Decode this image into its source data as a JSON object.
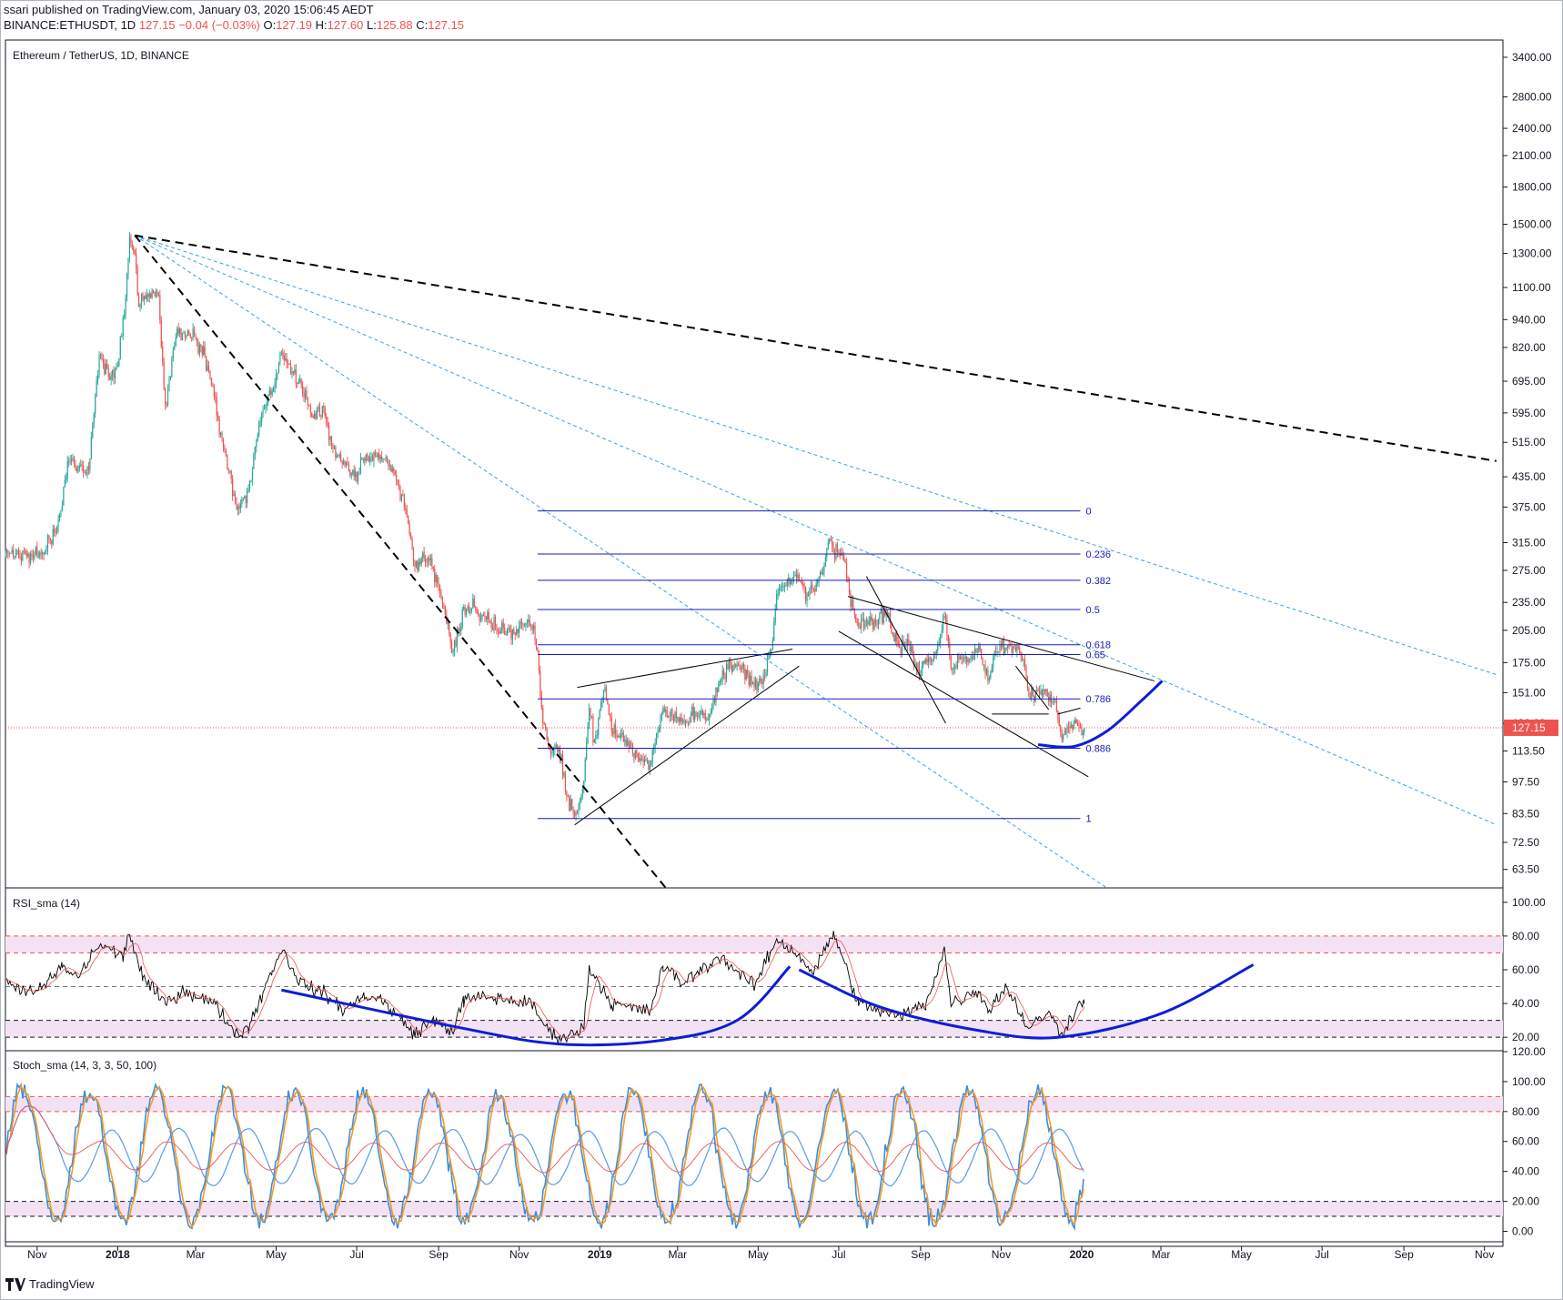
{
  "header": {
    "publisher": "ssari published on TradingView.com, January 03, 2020 15:06:45 AEDT",
    "symbol": "BINANCE:ETHUSDT, 1D",
    "last": "127.15",
    "change": "−0.04 (−0.03%)",
    "o_label": "O:",
    "o": "127.19",
    "h_label": "H:",
    "h": "127.60",
    "l_label": "L:",
    "l": "125.88",
    "c_label": "C:",
    "c": "127.15"
  },
  "footer": {
    "brand": "TradingView"
  },
  "colors": {
    "up": "#26a69a",
    "down": "#ef5350",
    "fib": "#1a1ab8",
    "arc": "#0d1ed6",
    "trend": "#000000",
    "fan": "#3aa3e3",
    "rsi": "#000000",
    "stoch_k": "#3d8ee0",
    "stoch_d": "#f59a23",
    "slow1": "#ef5350",
    "slow2": "#5b9be6"
  },
  "chart_data": [
    {
      "type": "candlestick",
      "title": "Ethereum / TetherUS, 1D, BINANCE",
      "scale": "log",
      "ylim": [
        58,
        3700
      ],
      "x_range": [
        "2017-10-08",
        "2020-11-15"
      ],
      "y_ticks": [
        "3400.00",
        "2800.00",
        "2400.00",
        "2100.00",
        "1800.00",
        "1500.00",
        "1300.00",
        "1100.00",
        "940.00",
        "820.00",
        "695.00",
        "595.00",
        "515.00",
        "435.00",
        "375.00",
        "315.00",
        "275.00",
        "235.00",
        "205.00",
        "175.00",
        "151.00",
        "130.00",
        "113.50",
        "97.50",
        "83.50",
        "72.50",
        "63.50"
      ],
      "last_price": "127.15",
      "close_path": [
        [
          "2017-10-08",
          300
        ],
        [
          "2017-10-25",
          298
        ],
        [
          "2017-11-05",
          300
        ],
        [
          "2017-11-15",
          330
        ],
        [
          "2017-11-25",
          470
        ],
        [
          "2017-12-03",
          460
        ],
        [
          "2017-12-10",
          450
        ],
        [
          "2017-12-18",
          790
        ],
        [
          "2017-12-26",
          700
        ],
        [
          "2018-01-01",
          750
        ],
        [
          "2018-01-07",
          1050
        ],
        [
          "2018-01-10",
          1410
        ],
        [
          "2018-01-14",
          1300
        ],
        [
          "2018-01-17",
          1000
        ],
        [
          "2018-01-24",
          1050
        ],
        [
          "2018-02-01",
          1060
        ],
        [
          "2018-02-06",
          620
        ],
        [
          "2018-02-15",
          900
        ],
        [
          "2018-02-22",
          870
        ],
        [
          "2018-03-01",
          860
        ],
        [
          "2018-03-10",
          750
        ],
        [
          "2018-03-20",
          540
        ],
        [
          "2018-04-01",
          370
        ],
        [
          "2018-04-10",
          410
        ],
        [
          "2018-04-20",
          590
        ],
        [
          "2018-04-28",
          660
        ],
        [
          "2018-05-05",
          800
        ],
        [
          "2018-05-13",
          730
        ],
        [
          "2018-05-20",
          680
        ],
        [
          "2018-05-29",
          580
        ],
        [
          "2018-06-06",
          610
        ],
        [
          "2018-06-12",
          510
        ],
        [
          "2018-06-22",
          460
        ],
        [
          "2018-06-29",
          435
        ],
        [
          "2018-07-07",
          470
        ],
        [
          "2018-07-16",
          480
        ],
        [
          "2018-07-24",
          470
        ],
        [
          "2018-08-01",
          420
        ],
        [
          "2018-08-08",
          360
        ],
        [
          "2018-08-14",
          280
        ],
        [
          "2018-08-20",
          300
        ],
        [
          "2018-08-27",
          280
        ],
        [
          "2018-09-05",
          230
        ],
        [
          "2018-09-12",
          185
        ],
        [
          "2018-09-20",
          230
        ],
        [
          "2018-09-28",
          230
        ],
        [
          "2018-10-05",
          220
        ],
        [
          "2018-10-15",
          205
        ],
        [
          "2018-10-25",
          205
        ],
        [
          "2018-11-05",
          210
        ],
        [
          "2018-11-12",
          210
        ],
        [
          "2018-11-15",
          185
        ],
        [
          "2018-11-19",
          130
        ],
        [
          "2018-11-25",
          112
        ],
        [
          "2018-12-01",
          115
        ],
        [
          "2018-12-07",
          91
        ],
        [
          "2018-12-15",
          84
        ],
        [
          "2018-12-20",
          98
        ],
        [
          "2018-12-24",
          140
        ],
        [
          "2018-12-28",
          120
        ],
        [
          "2019-01-05",
          155
        ],
        [
          "2019-01-10",
          125
        ],
        [
          "2019-01-20",
          120
        ],
        [
          "2019-01-30",
          110
        ],
        [
          "2019-02-08",
          106
        ],
        [
          "2019-02-18",
          140
        ],
        [
          "2019-02-25",
          135
        ],
        [
          "2019-03-05",
          132
        ],
        [
          "2019-03-15",
          137
        ],
        [
          "2019-03-25",
          136
        ],
        [
          "2019-04-02",
          160
        ],
        [
          "2019-04-10",
          172
        ],
        [
          "2019-04-20",
          170
        ],
        [
          "2019-04-28",
          155
        ],
        [
          "2019-05-05",
          165
        ],
        [
          "2019-05-12",
          195
        ],
        [
          "2019-05-15",
          245
        ],
        [
          "2019-05-21",
          255
        ],
        [
          "2019-05-30",
          265
        ],
        [
          "2019-06-07",
          245
        ],
        [
          "2019-06-12",
          250
        ],
        [
          "2019-06-18",
          270
        ],
        [
          "2019-06-24",
          320
        ],
        [
          "2019-06-27",
          300
        ],
        [
          "2019-07-01",
          300
        ],
        [
          "2019-07-06",
          285
        ],
        [
          "2019-07-10",
          230
        ],
        [
          "2019-07-16",
          210
        ],
        [
          "2019-07-22",
          215
        ],
        [
          "2019-07-29",
          212
        ],
        [
          "2019-08-06",
          225
        ],
        [
          "2019-08-15",
          190
        ],
        [
          "2019-08-23",
          192
        ],
        [
          "2019-08-29",
          168
        ],
        [
          "2019-09-05",
          178
        ],
        [
          "2019-09-12",
          182
        ],
        [
          "2019-09-19",
          220
        ],
        [
          "2019-09-24",
          170
        ],
        [
          "2019-10-01",
          180
        ],
        [
          "2019-10-08",
          178
        ],
        [
          "2019-10-15",
          190
        ],
        [
          "2019-10-22",
          160
        ],
        [
          "2019-10-27",
          185
        ],
        [
          "2019-11-05",
          188
        ],
        [
          "2019-11-12",
          185
        ],
        [
          "2019-11-18",
          178
        ],
        [
          "2019-11-22",
          148
        ],
        [
          "2019-11-29",
          152
        ],
        [
          "2019-12-06",
          148
        ],
        [
          "2019-12-12",
          145
        ],
        [
          "2019-12-17",
          120
        ],
        [
          "2019-12-21",
          128
        ],
        [
          "2019-12-28",
          130
        ],
        [
          "2020-01-03",
          127
        ]
      ],
      "fibonacci": {
        "x_start": "2018-11-15",
        "x_end": "2019-12-31",
        "levels": [
          {
            "label": "0",
            "value": 368
          },
          {
            "label": "0.236",
            "value": 298
          },
          {
            "label": "0.382",
            "value": 262
          },
          {
            "label": "0.5",
            "value": 227
          },
          {
            "label": "0.618",
            "value": 191
          },
          {
            "label": "0.65",
            "value": 182
          },
          {
            "label": "0.786",
            "value": 146.5
          },
          {
            "label": "0.886",
            "value": 115
          },
          {
            "label": "1",
            "value": 81.5
          }
        ]
      },
      "trendlines_dashed_black": [
        [
          [
            "2018-01-14",
            1420
          ],
          [
            "2020-11-10",
            470
          ]
        ],
        [
          [
            "2018-01-14",
            1420
          ],
          [
            "2019-02-20",
            58
          ]
        ]
      ],
      "trendlines_dashed_blue": [
        [
          [
            "2018-01-14",
            1420
          ],
          [
            "2020-11-10",
            165
          ]
        ],
        [
          [
            "2018-01-14",
            1420
          ],
          [
            "2020-11-10",
            79
          ]
        ],
        [
          [
            "2018-01-14",
            1420
          ],
          [
            "2020-01-20",
            58
          ]
        ]
      ],
      "trendlines_solid_black": [
        [
          [
            "2018-12-13",
            79
          ],
          [
            "2019-06-01",
            172
          ]
        ],
        [
          [
            "2018-12-15",
            155
          ],
          [
            "2019-05-27",
            187
          ]
        ],
        [
          [
            "2019-07-22",
            267
          ],
          [
            "2019-09-20",
            130
          ]
        ],
        [
          [
            "2019-07-08",
            242
          ],
          [
            "2020-02-25",
            160
          ]
        ],
        [
          [
            "2019-07-01",
            204
          ],
          [
            "2020-01-06",
            100
          ]
        ],
        [
          [
            "2019-10-25",
            136
          ],
          [
            "2019-12-07",
            136
          ]
        ],
        [
          [
            "2019-11-12",
            172
          ],
          [
            "2019-12-07",
            139
          ]
        ],
        [
          [
            "2019-12-14",
            136
          ],
          [
            "2019-12-31",
            140
          ]
        ]
      ],
      "arc": [
        [
          "2019-11-29",
          117
        ],
        [
          "2019-12-26",
          116
        ],
        [
          "2020-01-20",
          125
        ],
        [
          "2020-02-15",
          145
        ],
        [
          "2020-03-02",
          160
        ]
      ]
    },
    {
      "type": "line",
      "title": "RSI_sma (14)",
      "ylim": [
        12,
        108
      ],
      "y_ticks": [
        "100.00",
        "80.00",
        "60.00",
        "40.00",
        "20.00"
      ],
      "bands": {
        "overbought": [
          70,
          80
        ],
        "oversold": [
          20,
          30
        ]
      },
      "rsi_path": [
        [
          "2017-10-08",
          52
        ],
        [
          "2017-11-01",
          46
        ],
        [
          "2017-11-20",
          62
        ],
        [
          "2017-12-01",
          55
        ],
        [
          "2017-12-18",
          75
        ],
        [
          "2018-01-05",
          68
        ],
        [
          "2018-01-10",
          82
        ],
        [
          "2018-01-20",
          55
        ],
        [
          "2018-02-06",
          40
        ],
        [
          "2018-02-20",
          48
        ],
        [
          "2018-03-15",
          40
        ],
        [
          "2018-04-01",
          22
        ],
        [
          "2018-04-10",
          26
        ],
        [
          "2018-04-28",
          60
        ],
        [
          "2018-05-05",
          72
        ],
        [
          "2018-05-20",
          52
        ],
        [
          "2018-06-06",
          46
        ],
        [
          "2018-06-22",
          36
        ],
        [
          "2018-07-07",
          45
        ],
        [
          "2018-07-20",
          42
        ],
        [
          "2018-08-14",
          22
        ],
        [
          "2018-08-27",
          30
        ],
        [
          "2018-09-12",
          24
        ],
        [
          "2018-09-20",
          42
        ],
        [
          "2018-10-05",
          44
        ],
        [
          "2018-10-25",
          42
        ],
        [
          "2018-11-10",
          40
        ],
        [
          "2018-11-25",
          22
        ],
        [
          "2018-12-07",
          20
        ],
        [
          "2018-12-20",
          26
        ],
        [
          "2018-12-24",
          62
        ],
        [
          "2019-01-10",
          40
        ],
        [
          "2019-02-08",
          35
        ],
        [
          "2019-02-18",
          62
        ],
        [
          "2019-03-05",
          52
        ],
        [
          "2019-04-02",
          68
        ],
        [
          "2019-04-28",
          50
        ],
        [
          "2019-05-15",
          78
        ],
        [
          "2019-05-30",
          70
        ],
        [
          "2019-06-12",
          58
        ],
        [
          "2019-06-27",
          82
        ],
        [
          "2019-07-16",
          40
        ],
        [
          "2019-08-15",
          32
        ],
        [
          "2019-09-05",
          40
        ],
        [
          "2019-09-19",
          72
        ],
        [
          "2019-09-24",
          40
        ],
        [
          "2019-10-15",
          48
        ],
        [
          "2019-10-22",
          36
        ],
        [
          "2019-11-05",
          50
        ],
        [
          "2019-11-22",
          25
        ],
        [
          "2019-12-06",
          35
        ],
        [
          "2019-12-17",
          22
        ],
        [
          "2019-12-28",
          38
        ],
        [
          "2020-01-03",
          40
        ]
      ],
      "arcs": [
        [
          [
            "2018-05-05",
            48
          ],
          [
            "2018-09-15",
            26
          ],
          [
            "2018-12-01",
            16
          ],
          [
            "2019-02-15",
            18
          ],
          [
            "2019-04-15",
            30
          ],
          [
            "2019-05-25",
            62
          ]
        ],
        [
          [
            "2019-06-01",
            60
          ],
          [
            "2019-08-01",
            38
          ],
          [
            "2019-10-15",
            24
          ],
          [
            "2019-12-15",
            20
          ],
          [
            "2020-03-01",
            34
          ],
          [
            "2020-05-10",
            63
          ]
        ]
      ]
    },
    {
      "type": "line",
      "title": "Stoch_sma (14, 3, 3, 50, 100)",
      "ylim": [
        -7,
        120
      ],
      "y_ticks": [
        "120.00",
        "100.00",
        "80.00",
        "60.00",
        "40.00",
        "20.00",
        "0.00"
      ],
      "bands": {
        "overbought": [
          80,
          90
        ],
        "oversold": [
          10,
          20
        ]
      }
    }
  ],
  "x_axis": {
    "labels": [
      {
        "label": "Nov",
        "date": "2017-11-01"
      },
      {
        "label": "2018",
        "date": "2018-01-01",
        "bold": true
      },
      {
        "label": "Mar",
        "date": "2018-03-01"
      },
      {
        "label": "May",
        "date": "2018-05-01"
      },
      {
        "label": "Jul",
        "date": "2018-07-01"
      },
      {
        "label": "Sep",
        "date": "2018-09-01"
      },
      {
        "label": "Nov",
        "date": "2018-11-01"
      },
      {
        "label": "2019",
        "date": "2019-01-01",
        "bold": true
      },
      {
        "label": "Mar",
        "date": "2019-03-01"
      },
      {
        "label": "May",
        "date": "2019-05-01"
      },
      {
        "label": "Jul",
        "date": "2019-07-01"
      },
      {
        "label": "Sep",
        "date": "2019-09-01"
      },
      {
        "label": "Nov",
        "date": "2019-11-01"
      },
      {
        "label": "2020",
        "date": "2020-01-01",
        "bold": true
      },
      {
        "label": "Mar",
        "date": "2020-03-01"
      },
      {
        "label": "May",
        "date": "2020-05-01"
      },
      {
        "label": "Jul",
        "date": "2020-07-01"
      },
      {
        "label": "Sep",
        "date": "2020-09-01"
      },
      {
        "label": "Nov",
        "date": "2020-11-01"
      }
    ]
  }
}
